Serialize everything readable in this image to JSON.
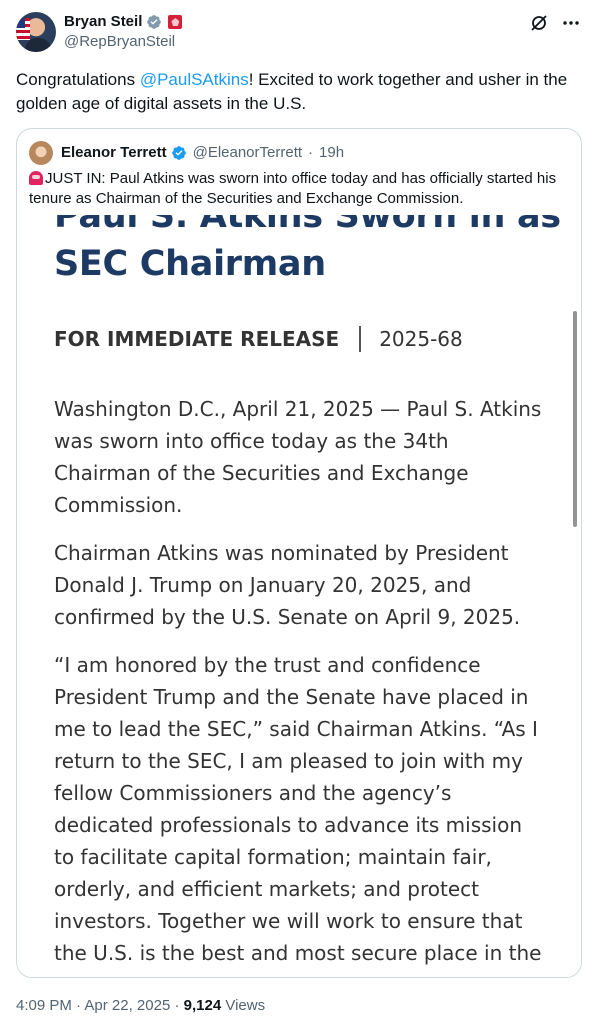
{
  "author": {
    "display_name": "Bryan Steil",
    "handle": "@RepBryanSteil",
    "verified_color": "#829aab",
    "gov_badge_icon": "government-badge-icon"
  },
  "top_icons": [
    "grok-icon",
    "more-icon"
  ],
  "tweet": {
    "text_before": "Congratulations ",
    "mention": "@PaulSAtkins",
    "text_after": "! Excited to work together and usher in the golden age of digital assets in the U.S."
  },
  "quoted": {
    "display_name": "Eleanor Terrett",
    "handle": "@EleanorTerrett",
    "separator": "·",
    "time": "19h",
    "verified_color": "#1d9bf0",
    "text": "JUST IN: Paul Atkins was sworn into office today and has officially started his tenure as Chairman of the Securities and Exchange Commission.",
    "image": {
      "title_line1": "Paul S. Atkins Sworn in as",
      "title_line2": "SEC Chairman",
      "release_label": "FOR IMMEDIATE RELEASE",
      "release_number": "2025-68",
      "paragraph1": "Washington D.C., April 21, 2025 — Paul S. Atkins was sworn into office today as the 34th Chairman of the Securities and Exchange Commission.",
      "paragraph2": "Chairman Atkins was nominated by President Donald J. Trump on January 20, 2025, and confirmed by the U.S. Senate on April 9, 2025.",
      "paragraph3": "“I am honored by the trust and confidence President Trump and the Senate have placed in me to lead the SEC,” said Chairman Atkins. “As I return to the SEC, I am pleased to join with my fellow Commissioners and the agency’s dedicated professionals to advance its mission to facilitate capital formation; maintain fair, orderly, and efficient markets; and protect investors. Together we will work to ensure that the U.S. is the best and most secure place in the"
    }
  },
  "footer": {
    "time": "4:09 PM",
    "date": "Apr 22, 2025",
    "separator": "·",
    "views_count": "9,124",
    "views_label": "Views"
  },
  "colors": {
    "accent": "#1d9bf0",
    "doc_title": "#1c3a63",
    "secondary_text": "#536471"
  }
}
